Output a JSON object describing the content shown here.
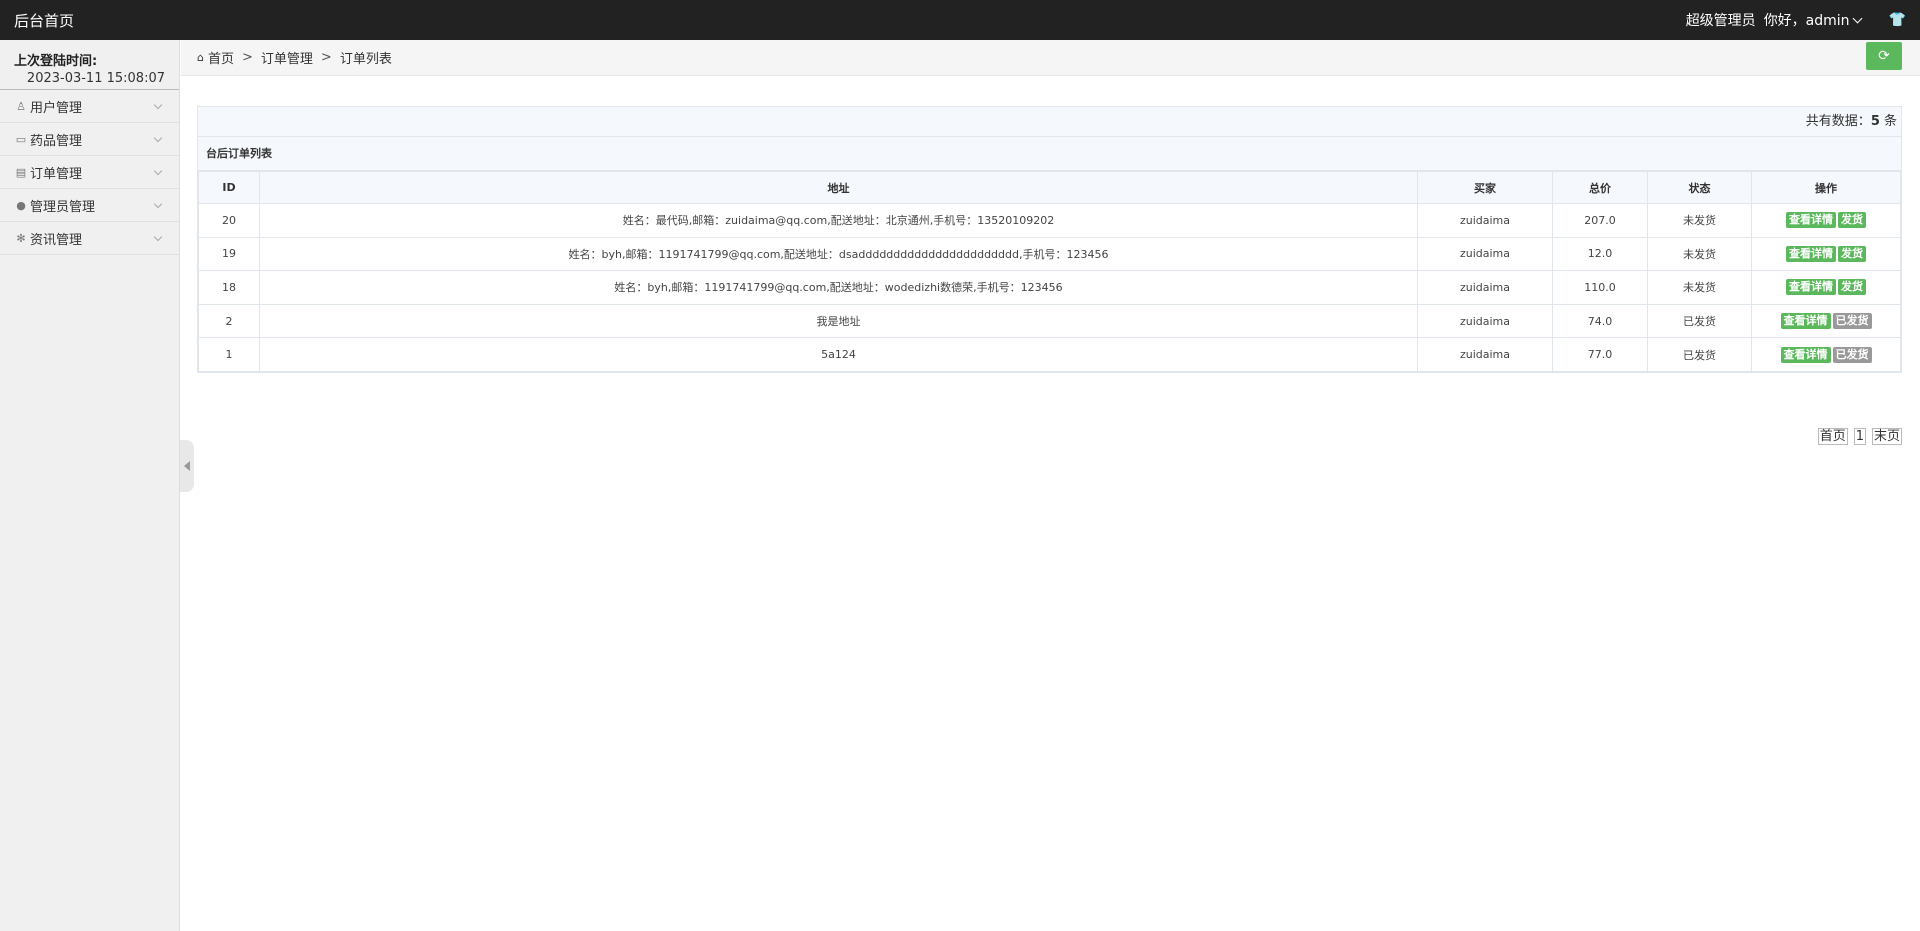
{
  "header": {
    "brand": "后台首页",
    "role": "超级管理员",
    "greeting": "你好，admin",
    "shirt_icon": "shirt-icon"
  },
  "sidebar": {
    "last_login_label": "上次登陆时间:",
    "last_login_value": "2023-03-11 15:08:07",
    "items": [
      {
        "label": "用户管理",
        "icon": "user-icon"
      },
      {
        "label": "药品管理",
        "icon": "bag-icon"
      },
      {
        "label": "订单管理",
        "icon": "card-icon"
      },
      {
        "label": "管理员管理",
        "icon": "person-icon"
      },
      {
        "label": "资讯管理",
        "icon": "gear-icon"
      }
    ]
  },
  "breadcrumb": {
    "home": "首页",
    "sep": ">",
    "level1": "订单管理",
    "level2": "订单列表"
  },
  "summary": {
    "prefix": "共有数据：",
    "count": "5",
    "suffix": " 条"
  },
  "table": {
    "title": "台后订单列表",
    "columns": [
      "ID",
      "地址",
      "买家",
      "总价",
      "状态",
      "操作"
    ],
    "rows": [
      {
        "id": "20",
        "address": "姓名：最代码,邮箱：zuidaima@qq.com,配送地址：北京通州,手机号：13520109202",
        "buyer": "zuidaima",
        "total": "207.0",
        "status": "未发货",
        "view": "查看详情",
        "action": "发货",
        "shipped": false
      },
      {
        "id": "19",
        "address": "姓名：byh,邮箱：1191741799@qq.com,配送地址：dsaddddddddddddddddddddddd,手机号：123456",
        "buyer": "zuidaima",
        "total": "12.0",
        "status": "未发货",
        "view": "查看详情",
        "action": "发货",
        "shipped": false
      },
      {
        "id": "18",
        "address": "姓名：byh,邮箱：1191741799@qq.com,配送地址：wodedizhi数德荣,手机号：123456",
        "buyer": "zuidaima",
        "total": "110.0",
        "status": "未发货",
        "view": "查看详情",
        "action": "发货",
        "shipped": false
      },
      {
        "id": "2",
        "address": "我是地址",
        "buyer": "zuidaima",
        "total": "74.0",
        "status": "已发货",
        "view": "查看详情",
        "action": "已发货",
        "shipped": true
      },
      {
        "id": "1",
        "address": "5a124",
        "buyer": "zuidaima",
        "total": "77.0",
        "status": "已发货",
        "view": "查看详情",
        "action": "已发货",
        "shipped": true
      }
    ]
  },
  "pager": {
    "first": "首页",
    "current": "1",
    "last": "末页"
  },
  "colors": {
    "topbar": "#222222",
    "success": "#5cb85c",
    "disabled": "#999999"
  }
}
